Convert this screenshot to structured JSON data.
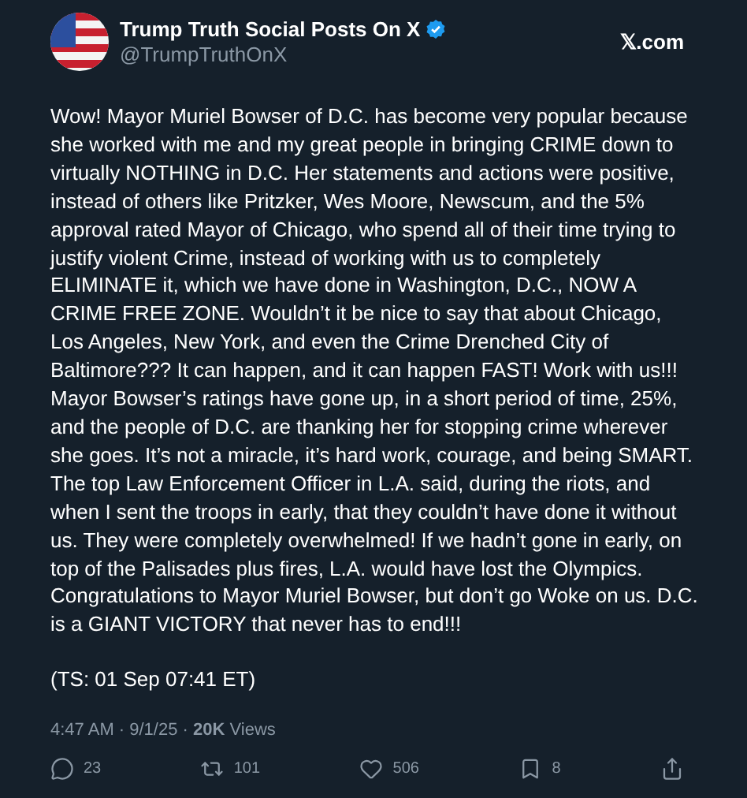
{
  "author": {
    "name": "Trump Truth Social Posts On X",
    "verified": true,
    "handle": "@TrumpTruthOnX"
  },
  "source": "𝕏.com",
  "paragraphs": [
    "Wow! Mayor Muriel Bowser of D.C. has become very popular because she worked with me and my great people in bringing CRIME down to virtually NOTHING in D.C. Her statements and actions were positive, instead of others like Pritzker, Wes Moore, Newscum, and the 5% approval rated Mayor of Chicago, who spend all of their time trying to justify violent Crime, instead of working with us to completely ELIMINATE it, which we have done in Washington, D.C., NOW A CRIME FREE ZONE. Wouldn’t it be nice to say that about Chicago, Los Angeles, New York, and even the Crime Drenched City of Baltimore??? It can happen, and it can happen FAST! Work with us!!! Mayor Bowser’s ratings have gone up, in a short period of time, 25%, and the people of D.C. are thanking her for stopping crime wherever she goes. It’s not a miracle, it’s hard work, courage, and being SMART. The top Law Enforcement Officer in L.A. said, during the riots, and when I sent the troops in early, that they couldn’t have done it without us. They were completely overwhelmed! If we hadn’t gone in early, on top of the Palisades plus fires, L.A. would have lost the Olympics. Congratulations to Mayor Muriel Bowser, but don’t go Woke on us. D.C. is a GIANT VICTORY that never has to end!!!",
    "(TS: 01 Sep 07:41 ET)"
  ],
  "meta": "4:47 AM · 9/1/25 · **20K** Views",
  "actions": [
    {
      "kind": "reply",
      "count": "23"
    },
    {
      "kind": "repost",
      "count": "101"
    },
    {
      "kind": "like",
      "count": "506"
    },
    {
      "kind": "bookmark",
      "count": "8"
    },
    {
      "kind": "share"
    }
  ]
}
